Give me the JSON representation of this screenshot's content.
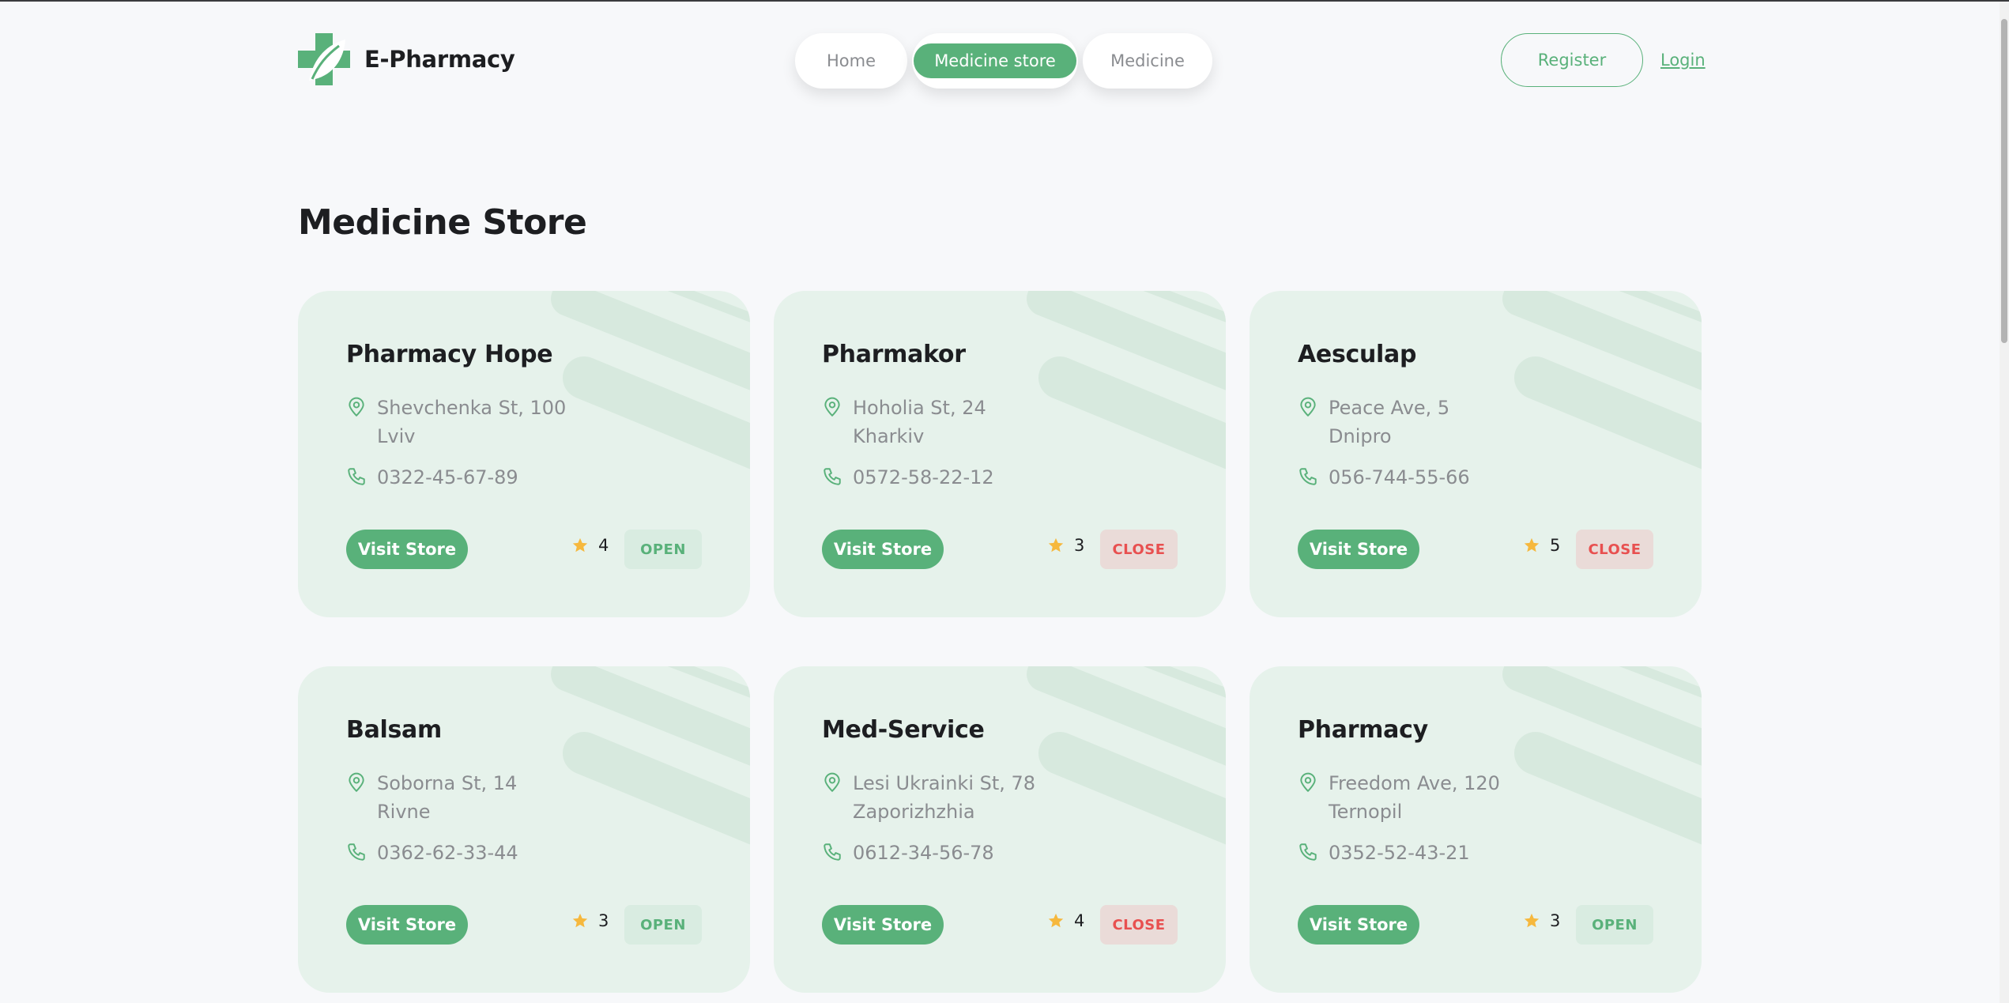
{
  "app": {
    "name": "E-Pharmacy"
  },
  "nav": {
    "items": [
      {
        "label": "Home",
        "active": false
      },
      {
        "label": "Medicine store",
        "active": true
      },
      {
        "label": "Medicine",
        "active": false
      }
    ]
  },
  "auth": {
    "register_label": "Register",
    "login_label": "Login"
  },
  "page": {
    "title": "Medicine Store"
  },
  "colors": {
    "accent": "#59b17a",
    "card_bg": "#e6f2eb",
    "open_bg": "#d9ece1",
    "close_bg": "#eadbd8",
    "close_text": "#e85050",
    "star": "#f6b83d"
  },
  "stores": [
    {
      "name": "Pharmacy Hope",
      "street": "Shevchenka St, 100",
      "city": "Lviv",
      "phone": "0322-45-67-89",
      "visit_label": "Visit Store",
      "rating": "4",
      "status": "OPEN"
    },
    {
      "name": "Pharmakor",
      "street": "Hoholia St, 24",
      "city": "Kharkiv",
      "phone": "0572-58-22-12",
      "visit_label": "Visit Store",
      "rating": "3",
      "status": "CLOSE"
    },
    {
      "name": "Aesculap",
      "street": "Peace Ave, 5",
      "city": "Dnipro",
      "phone": "056-744-55-66",
      "visit_label": "Visit Store",
      "rating": "5",
      "status": "CLOSE"
    },
    {
      "name": "Balsam",
      "street": "Soborna St, 14",
      "city": "Rivne",
      "phone": "0362-62-33-44",
      "visit_label": "Visit Store",
      "rating": "3",
      "status": "OPEN"
    },
    {
      "name": "Med-Service",
      "street": "Lesi Ukrainki St, 78",
      "city": "Zaporizhzhia",
      "phone": "0612-34-56-78",
      "visit_label": "Visit Store",
      "rating": "4",
      "status": "CLOSE"
    },
    {
      "name": "Pharmacy",
      "street": "Freedom Ave, 120",
      "city": "Ternopil",
      "phone": "0352-52-43-21",
      "visit_label": "Visit Store",
      "rating": "3",
      "status": "OPEN"
    }
  ]
}
